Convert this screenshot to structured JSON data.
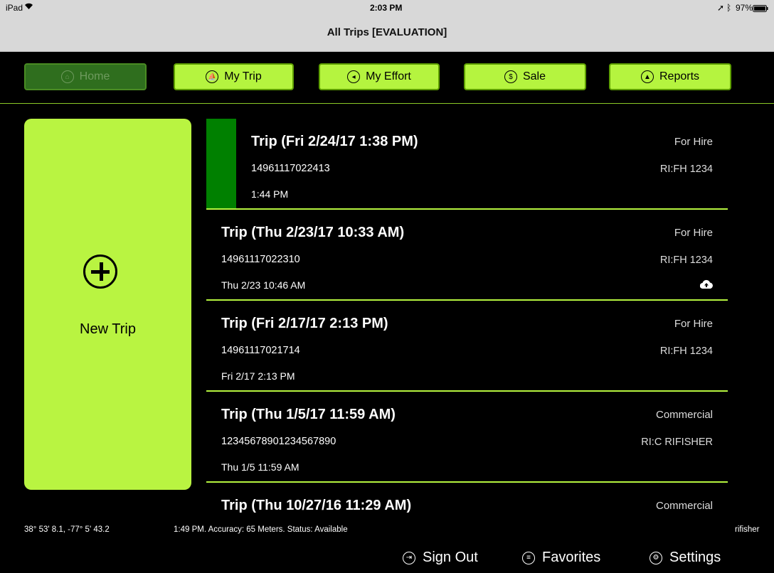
{
  "status_bar": {
    "device": "iPad",
    "time": "2:03 PM",
    "battery": "97%"
  },
  "title_bar": {
    "title": "All Trips [EVALUATION]"
  },
  "nav": {
    "home": "Home",
    "my_trip": "My Trip",
    "my_effort": "My Effort",
    "sale": "Sale",
    "reports": "Reports"
  },
  "new_trip": {
    "label": "New Trip"
  },
  "trips": [
    {
      "title": "Trip (Fri 2/24/17 1:38 PM)",
      "id": "14961117022413",
      "time": "1:44 PM",
      "type": "For Hire",
      "permit": "RI:FH 1234"
    },
    {
      "title": "Trip (Thu 2/23/17 10:33 AM)",
      "id": "14961117022310",
      "time": "Thu 2/23 10:46 AM",
      "type": "For Hire",
      "permit": "RI:FH 1234",
      "icon": "cloud-upload-icon"
    },
    {
      "title": "Trip (Fri 2/17/17 2:13 PM)",
      "id": "14961117021714",
      "time": "Fri 2/17 2:13 PM",
      "type": "For Hire",
      "permit": "RI:FH 1234"
    },
    {
      "title": "Trip (Thu 1/5/17 11:59 AM)",
      "id": "12345678901234567890",
      "time": "Thu 1/5 11:59 AM",
      "type": "Commercial",
      "permit": "RI:C RIFISHER"
    },
    {
      "title": "Trip (Thu 10/27/16 11:29 AM)",
      "id": "",
      "time": "",
      "type": "Commercial",
      "permit": ""
    }
  ],
  "footer": {
    "coords": "38° 53' 8.1,  -77° 5' 43.2",
    "gps_status": "1:49 PM.  Accuracy: 65 Meters.  Status: Available",
    "user": "rifisher"
  },
  "bottom_bar": {
    "sign_out": "Sign Out",
    "favorites": "Favorites",
    "settings": "Settings"
  },
  "colors": {
    "accent": "#b5f43f",
    "selected": "#008000",
    "background": "#000000"
  }
}
